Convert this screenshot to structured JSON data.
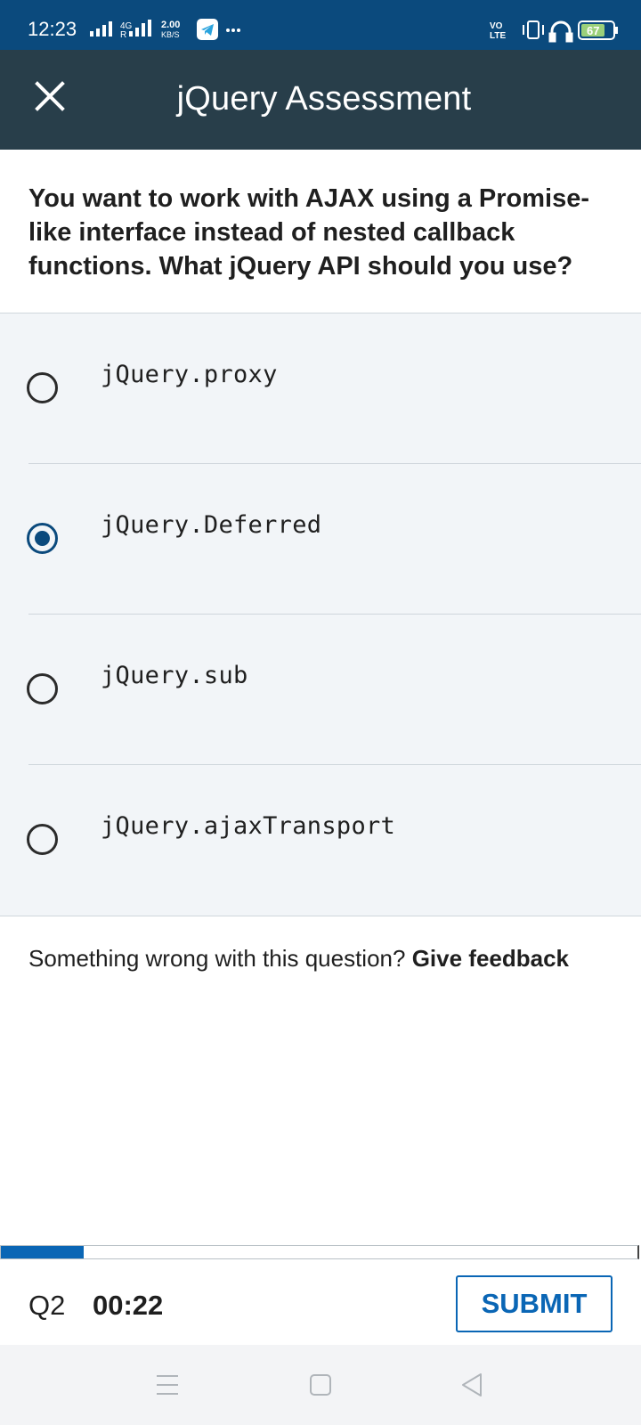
{
  "status_bar": {
    "time": "12:23",
    "network": "4G",
    "speed_value": "2.00",
    "speed_unit": "KB/S",
    "volte": "VO LTE",
    "battery": "67"
  },
  "header": {
    "title": "jQuery Assessment",
    "close_icon": "close-icon"
  },
  "question": {
    "text": "You want to work with AJAX using a Promise-like interface instead of nested callback functions. What jQuery API should you use?"
  },
  "options": [
    {
      "label": "jQuery.proxy",
      "selected": false
    },
    {
      "label": "jQuery.Deferred",
      "selected": true
    },
    {
      "label": "jQuery.sub",
      "selected": false
    },
    {
      "label": "jQuery.ajaxTransport",
      "selected": false
    }
  ],
  "feedback": {
    "prompt": "Something wrong with this question?",
    "link": "Give feedback"
  },
  "footer": {
    "question_number": "Q2",
    "timer": "00:22",
    "submit_label": "SUBMIT",
    "progress_fraction": 0.13
  },
  "colors": {
    "status_bar": "#0b4a7d",
    "app_bar": "#283e4a",
    "accent": "#0a66b5",
    "options_bg": "#f2f5f8"
  },
  "nav": {
    "icons": [
      "menu-icon",
      "home-square-icon",
      "back-triangle-icon"
    ]
  }
}
